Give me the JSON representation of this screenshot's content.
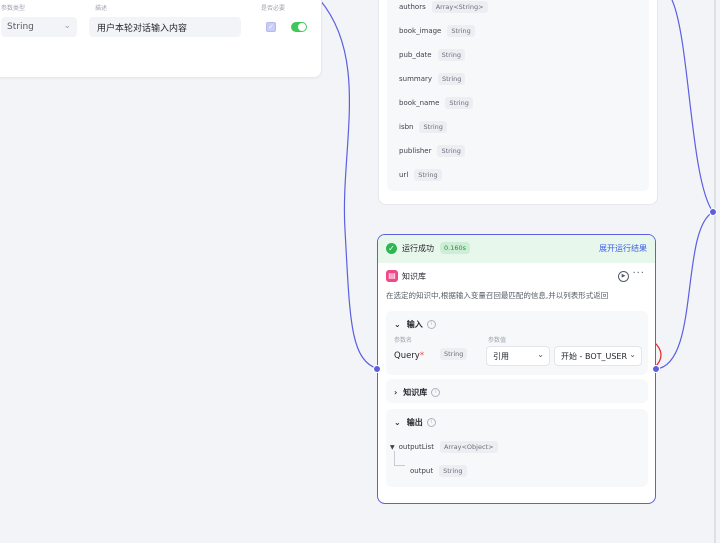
{
  "left_node": {
    "col_type_header": "参数类型",
    "col_desc_header": "描述",
    "col_required_header": "是否必要",
    "type_value": "String",
    "description_value": "用户本轮对话输入内容"
  },
  "output_fields": [
    {
      "name": "authors",
      "type": "Array<String>"
    },
    {
      "name": "book_image",
      "type": "String"
    },
    {
      "name": "pub_date",
      "type": "String"
    },
    {
      "name": "summary",
      "type": "String"
    },
    {
      "name": "book_name",
      "type": "String"
    },
    {
      "name": "isbn",
      "type": "String"
    },
    {
      "name": "publisher",
      "type": "String"
    },
    {
      "name": "url",
      "type": "String"
    }
  ],
  "knowledge_node": {
    "run_status": "运行成功",
    "run_time": "0.160s",
    "expand_label": "展开运行结果",
    "title": "知识库",
    "description": "在选定的知识中,根据输入变量召回最匹配的信息,并以列表形式返回",
    "input_section": {
      "title": "输入",
      "param_name_header": "参数名",
      "param_value_header": "参数值",
      "param_name": "Query",
      "required_mark": "*",
      "param_type": "String",
      "ref_mode": "引用",
      "ref_value": "开始 - BOT_USER"
    },
    "knowledge_section": {
      "title": "知识库"
    },
    "output_section": {
      "title": "输出",
      "list_name": "outputList",
      "list_type": "Array<Object>",
      "child_name": "output",
      "child_type": "String"
    }
  },
  "colors": {
    "accent": "#5b5fe0",
    "success": "#2fb552",
    "annotation": "#e03030",
    "link": "#3b5ee5"
  }
}
